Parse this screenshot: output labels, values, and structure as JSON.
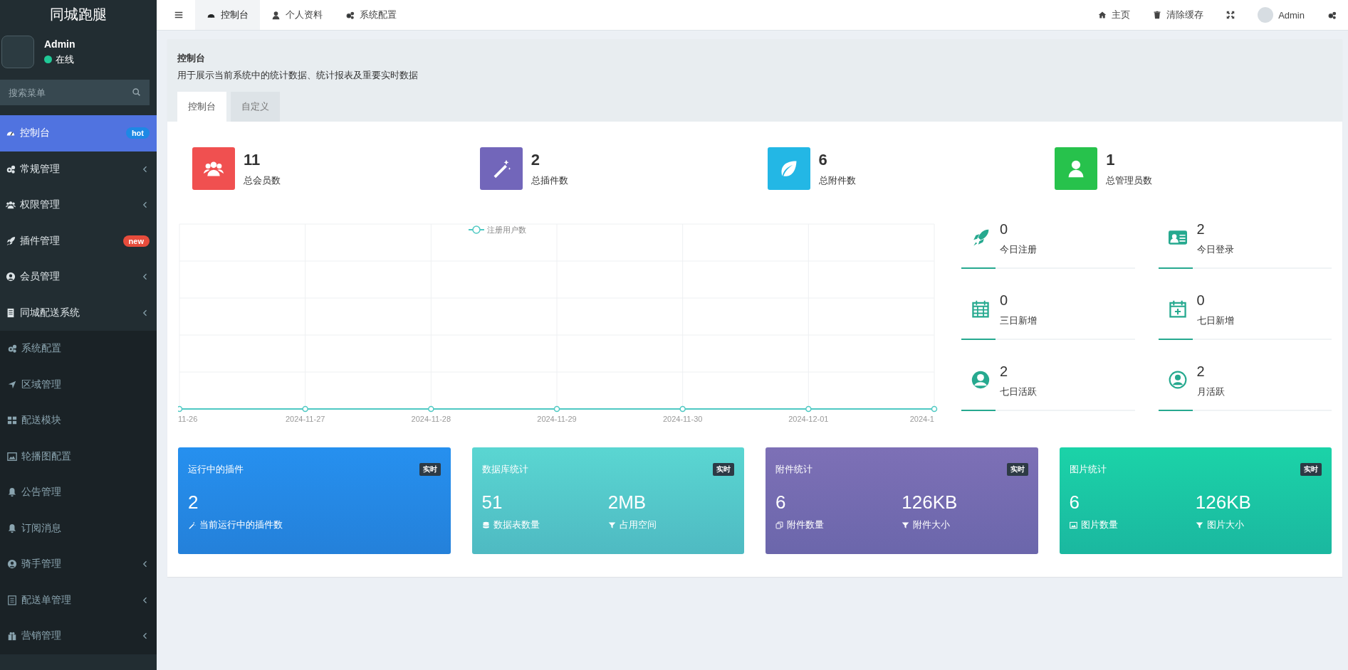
{
  "sidebar": {
    "title": "同城跑腿",
    "user": {
      "name": "Admin",
      "status": "在线",
      "online": true
    },
    "search": {
      "placeholder": "搜索菜单"
    },
    "items": [
      {
        "label": "控制台",
        "selected": true,
        "badge": {
          "text": "hot",
          "color": "#1e88e5"
        }
      },
      {
        "label": "常规管理",
        "selected": false,
        "kind": "submenu"
      },
      {
        "label": "权限管理",
        "selected": false,
        "kind": "submenu"
      },
      {
        "label": "插件管理",
        "selected": false,
        "badge": {
          "text": "new",
          "color": "#e74c3c"
        }
      },
      {
        "label": "会员管理",
        "selected": false,
        "kind": "submenu"
      },
      {
        "label": "同城配送系统",
        "selected": false,
        "kind": "submenu",
        "children": [
          {
            "label": "系统配置",
            "selected": false
          },
          {
            "label": "区域管理",
            "selected": false
          },
          {
            "label": "配送模块",
            "selected": false
          },
          {
            "label": "轮播图配置",
            "selected": false
          },
          {
            "label": "公告管理",
            "selected": false
          },
          {
            "label": "订阅消息",
            "selected": false
          },
          {
            "label": "骑手管理",
            "selected": false,
            "kind": "submenu"
          },
          {
            "label": "配送单管理",
            "selected": false,
            "kind": "submenu"
          },
          {
            "label": "营销管理",
            "selected": false,
            "kind": "submenu"
          }
        ]
      }
    ]
  },
  "topbar": {
    "tabs": [
      {
        "label": "控制台",
        "selected": true
      },
      {
        "label": "个人资料",
        "selected": false
      },
      {
        "label": "系统配置",
        "selected": false
      }
    ],
    "links": [
      {
        "label": "主页"
      },
      {
        "label": "清除缓存"
      }
    ],
    "user": "Admin"
  },
  "page": {
    "title": "控制台",
    "description": "用于展示当前系统中的统计数据、统计报表及重要实时数据",
    "tabs": [
      {
        "label": "控制台",
        "selected": true
      },
      {
        "label": "自定义",
        "selected": false
      }
    ]
  },
  "stats": [
    {
      "value": "11",
      "label": "总会员数",
      "color": "#f05050"
    },
    {
      "value": "2",
      "label": "总插件数",
      "color": "#7266ba"
    },
    {
      "value": "6",
      "label": "总附件数",
      "color": "#23b7e5"
    },
    {
      "value": "1",
      "label": "总管理员数",
      "color": "#27c24c"
    }
  ],
  "chart": {
    "legend": "注册用户数",
    "x_labels": [
      "11-26",
      "2024-11-27",
      "2024-11-28",
      "2024-11-29",
      "2024-11-30",
      "2024-12-01",
      "2024-1"
    ]
  },
  "activity": [
    {
      "value": "0",
      "label": "今日注册"
    },
    {
      "value": "2",
      "label": "今日登录"
    },
    {
      "value": "0",
      "label": "三日新增"
    },
    {
      "value": "0",
      "label": "七日新增"
    },
    {
      "value": "2",
      "label": "七日活跃"
    },
    {
      "value": "2",
      "label": "月活跃"
    }
  ],
  "panels": [
    {
      "title": "运行中的插件",
      "badge": "实时",
      "color": "#2690ef",
      "metrics": [
        {
          "value": "2",
          "label": "当前运行中的插件数"
        }
      ]
    },
    {
      "title": "数据库统计",
      "badge": "实时",
      "color": "#5ad6d2",
      "metrics": [
        {
          "value": "51",
          "label": "数据表数量"
        },
        {
          "value": "2MB",
          "label": "占用空间"
        }
      ]
    },
    {
      "title": "附件统计",
      "badge": "实时",
      "color": "#7d70b6",
      "metrics": [
        {
          "value": "6",
          "label": "附件数量"
        },
        {
          "value": "126KB",
          "label": "附件大小"
        }
      ]
    },
    {
      "title": "图片统计",
      "badge": "实时",
      "color": "#1bd3a8",
      "metrics": [
        {
          "value": "6",
          "label": "图片数量"
        },
        {
          "value": "126KB",
          "label": "图片大小"
        }
      ]
    }
  ]
}
